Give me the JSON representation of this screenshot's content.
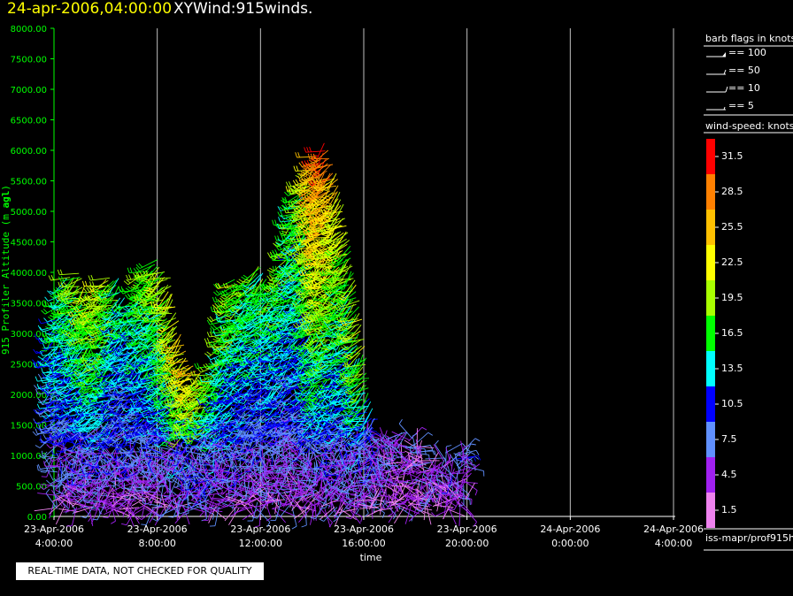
{
  "header": {
    "date_time": "24-apr-2006,04:00:00",
    "title": "XYWind:915winds."
  },
  "chart_data": {
    "type": "scatter",
    "mark": "wind-barbs",
    "ylabel_plain": "915 Profiler Altitude (m ",
    "ylabel_bold": "agl",
    "ylabel_close": ")",
    "xlabel": "time",
    "ylim": [
      0,
      8000
    ],
    "yticks": [
      "0.00",
      "500.00",
      "1000.00",
      "1500.00",
      "2000.00",
      "2500.00",
      "3000.00",
      "3500.00",
      "4000.00",
      "4500.00",
      "5000.00",
      "5500.00",
      "6000.00",
      "6500.00",
      "7000.00",
      "7500.00",
      "8000.00"
    ],
    "xlim_hours": [
      0,
      24
    ],
    "xticks": [
      {
        "h": 0,
        "date": "23-Apr-2006",
        "time": "4:00:00"
      },
      {
        "h": 4,
        "date": "23-Apr-2006",
        "time": "8:00:00"
      },
      {
        "h": 8,
        "date": "23-Apr-2006",
        "time": "12:00:00"
      },
      {
        "h": 12,
        "date": "23-Apr-2006",
        "time": "16:00:00"
      },
      {
        "h": 16,
        "date": "23-Apr-2006",
        "time": "20:00:00"
      },
      {
        "h": 20,
        "date": "24-Apr-2006",
        "time": "0:00:00"
      },
      {
        "h": 24,
        "date": "24-Apr-2006",
        "time": "4:00:00"
      }
    ],
    "vertical_grid": true,
    "data_hours": [
      0,
      15.9
    ],
    "columns": [
      {
        "h": 0.1,
        "top": 3100,
        "peak": 14
      },
      {
        "h": 0.5,
        "top": 3900,
        "peak": 16
      },
      {
        "h": 1.0,
        "top": 4000,
        "peak": 18
      },
      {
        "h": 1.5,
        "top": 3500,
        "peak": 20
      },
      {
        "h": 2.0,
        "top": 3950,
        "peak": 22
      },
      {
        "h": 2.5,
        "top": 3900,
        "peak": 17
      },
      {
        "h": 3.0,
        "top": 3300,
        "peak": 13
      },
      {
        "h": 3.5,
        "top": 4000,
        "peak": 18
      },
      {
        "h": 4.0,
        "top": 4250,
        "peak": 19
      },
      {
        "h": 4.5,
        "top": 3900,
        "peak": 20
      },
      {
        "h": 5.0,
        "top": 2800,
        "peak": 24
      },
      {
        "h": 5.5,
        "top": 2400,
        "peak": 26
      },
      {
        "h": 6.0,
        "top": 2300,
        "peak": 21
      },
      {
        "h": 6.5,
        "top": 2600,
        "peak": 16
      },
      {
        "h": 7.0,
        "top": 3900,
        "peak": 20
      },
      {
        "h": 7.5,
        "top": 3800,
        "peak": 17
      },
      {
        "h": 8.0,
        "top": 4200,
        "peak": 18
      },
      {
        "h": 8.5,
        "top": 3500,
        "peak": 15
      },
      {
        "h": 9.0,
        "top": 4300,
        "peak": 19
      },
      {
        "h": 9.5,
        "top": 5300,
        "peak": 16
      },
      {
        "h": 10.0,
        "top": 5700,
        "peak": 22
      },
      {
        "h": 10.5,
        "top": 6150,
        "peak": 31
      },
      {
        "h": 11.0,
        "top": 5600,
        "peak": 25
      },
      {
        "h": 11.5,
        "top": 4500,
        "peak": 19
      },
      {
        "h": 12.0,
        "top": 3000,
        "peak": 21
      },
      {
        "h": 12.5,
        "top": 1300,
        "peak": 7
      },
      {
        "h": 13.0,
        "top": 1300,
        "peak": 6
      },
      {
        "h": 13.5,
        "top": 1400,
        "peak": 6
      },
      {
        "h": 14.0,
        "top": 1300,
        "peak": 5
      },
      {
        "h": 14.5,
        "top": 900,
        "peak": 5
      },
      {
        "h": 15.0,
        "top": 1000,
        "peak": 6
      },
      {
        "h": 15.5,
        "top": 1100,
        "peak": 8
      }
    ],
    "barb_legend": {
      "title": "barb flags in knots",
      "entries": [
        "== 100",
        "== 50",
        "== 10",
        "== 5"
      ]
    },
    "speed_scale": {
      "title": "wind-speed: knots",
      "bins": [
        {
          "label": "31.5",
          "color": "#ff0000"
        },
        {
          "label": "28.5",
          "color": "#ff8000"
        },
        {
          "label": "25.5",
          "color": "#ffc000"
        },
        {
          "label": "22.5",
          "color": "#ffff00"
        },
        {
          "label": "19.5",
          "color": "#a8ff00"
        },
        {
          "label": "16.5",
          "color": "#00ff00"
        },
        {
          "label": "13.5",
          "color": "#00ffff"
        },
        {
          "label": "10.5",
          "color": "#0000ff"
        },
        {
          "label": "7.5",
          "color": "#6090ff"
        },
        {
          "label": "4.5",
          "color": "#a020f0"
        },
        {
          "label": "1.5",
          "color": "#ee82ee"
        }
      ]
    }
  },
  "footer": {
    "ident": "iss-mapr/prof915h",
    "notice": "REAL-TIME DATA, NOT CHECKED FOR QUALITY"
  },
  "colors": {
    "axis": "#00ff00",
    "grid": "#c0c0c0",
    "title_date": "#ffff00"
  }
}
